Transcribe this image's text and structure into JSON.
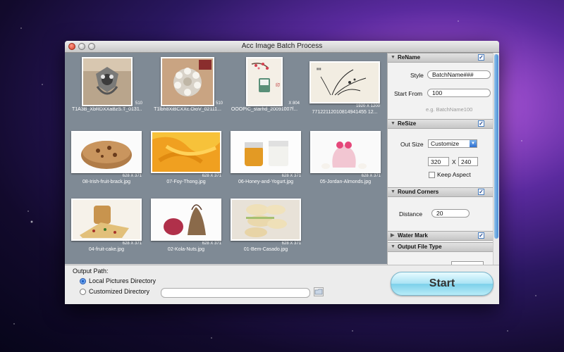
{
  "window": {
    "title": "Acc Image Batch Process"
  },
  "gallery": {
    "items": [
      {
        "filename": "T1A3B_XbRDXXaBzS.T_0131...",
        "dimensions": "510"
      },
      {
        "filename": "T1lbh8XiBCXXc.OioV_02111...",
        "dimensions": "510"
      },
      {
        "filename": "OOOPIC_starhd_20091007f...",
        "dimensions": "X 804"
      },
      {
        "filename": "77122112010814941455 12...",
        "dimensions": "1920 X 1200"
      },
      {
        "filename": "08-Irish-fruit-brack.jpg",
        "dimensions": "628 X 371"
      },
      {
        "filename": "07-Foy-Thong.jpg",
        "dimensions": "628 X 371"
      },
      {
        "filename": "06-Honey-and-Yogurt.jpg",
        "dimensions": "628 X 371"
      },
      {
        "filename": "05-Jordan-Almonds.jpg",
        "dimensions": "628 X 371"
      },
      {
        "filename": "04-fruit-cake.jpg",
        "dimensions": "628 X 371"
      },
      {
        "filename": "02-Kola-Nuts.jpg",
        "dimensions": "628 X 371"
      },
      {
        "filename": "01-Bem-Casado.jpg",
        "dimensions": "628 X 371"
      }
    ]
  },
  "panel": {
    "rename": {
      "title": "ReName",
      "checked": true,
      "style_label": "Style",
      "style_value": "BatchName###",
      "start_label": "Start From",
      "start_value": "100",
      "example": "e.g. BatchName100"
    },
    "resize": {
      "title": "ReSize",
      "checked": true,
      "outsize_label": "Out Size",
      "outsize_value": "Customize",
      "width": "320",
      "x_label": "X",
      "height": "240",
      "keep_aspect_label": "Keep Aspect",
      "keep_aspect": false
    },
    "round_corners": {
      "title": "Round Corners",
      "checked": true,
      "distance_label": "Distance",
      "distance_value": "20"
    },
    "water_mark": {
      "title": "Water Mark",
      "checked": true
    },
    "output_file_type": {
      "title": "Output File Type"
    }
  },
  "output": {
    "path_label": "Output Path:",
    "local_label": "Local Pictures Directory",
    "custom_label": "Customized Directory",
    "selected": "local"
  },
  "start_button": {
    "label": "Start"
  },
  "icons": {
    "close": "close-icon",
    "folder": "folder-icon",
    "check": "checkmark-icon",
    "disclosure": "disclosure-triangle-icon"
  },
  "colors": {
    "gallery_bg": "#7f8a95",
    "start_button": "#a9e3f4",
    "accent": "#3a7bd5"
  }
}
